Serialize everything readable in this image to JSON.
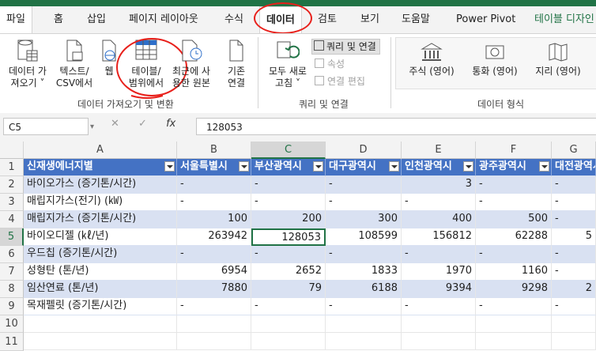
{
  "tabs": [
    "파일",
    "홈",
    "삽입",
    "페이지 레이아웃",
    "수식",
    "데이터",
    "검토",
    "보기",
    "도움말",
    "Power Pivot",
    "테이블 디자인"
  ],
  "ribbon": {
    "get_data": {
      "line1": "데이터 가",
      "line2": "져오기 ˅"
    },
    "text_csv": {
      "line1": "텍스트/",
      "line2": "CSV에서"
    },
    "web": {
      "line1": "웹"
    },
    "table_range": {
      "line1": "테이블/",
      "line2": "범위에서"
    },
    "recent_sources": {
      "line1": "최근에 사",
      "line2": "용한 원본"
    },
    "existing_conn": {
      "line1": "기존",
      "line2": "연결"
    },
    "get_transform_label": "데이터 가져오기 및 변환",
    "refresh_all": {
      "line1": "모두 새로",
      "line2": "고침 ˅"
    },
    "queries_connections": "쿼리 및 연결",
    "properties": "속성",
    "edit_links": "연결 편집",
    "queries_label": "쿼리 및 연결",
    "stocks": "주식 (영어)",
    "currency": "통화 (영어)",
    "geography": "지리 (영어)",
    "data_types_label": "데이터 형식"
  },
  "formula_bar": {
    "name_box": "C5",
    "cancel": "✕",
    "enter": "✓",
    "fx": "fx",
    "content": "128053"
  },
  "columns": [
    "A",
    "B",
    "C",
    "D",
    "E",
    "F",
    "G"
  ],
  "rows": [
    "1",
    "2",
    "3",
    "4",
    "5",
    "6",
    "7",
    "8",
    "9",
    "10",
    "11"
  ],
  "table": {
    "headers": [
      "신재생에너지별",
      "서울특별시",
      "부산광역시",
      "대구광역시",
      "인천광역시",
      "광주광역시",
      "대전광역시"
    ],
    "data": [
      [
        "바이오가스 (증기톤/시간)",
        "-",
        "-",
        "-",
        "3",
        "-",
        "-"
      ],
      [
        "매립지가스(전기) (㎾)",
        "-",
        "-",
        "-",
        "-",
        "-",
        "-"
      ],
      [
        "매립지가스 (증기톤/시간)",
        "100",
        "200",
        "300",
        "400",
        "500",
        "-"
      ],
      [
        "바이오디젤 (㎘/년)",
        "263942",
        "128053",
        "108599",
        "156812",
        "62288",
        "5"
      ],
      [
        "우드칩 (증기톤/시간)",
        "-",
        "-",
        "-",
        "-",
        "-",
        "-"
      ],
      [
        "성형탄 (톤/년)",
        "6954",
        "2652",
        "1833",
        "1970",
        "1160",
        "-"
      ],
      [
        "임산연료 (톤/년)",
        "7880",
        "79",
        "6188",
        "9394",
        "9298",
        "2"
      ],
      [
        "목재펠릿 (증기톤/시간)",
        "-",
        "-",
        "-",
        "-",
        "-",
        "-"
      ]
    ]
  }
}
